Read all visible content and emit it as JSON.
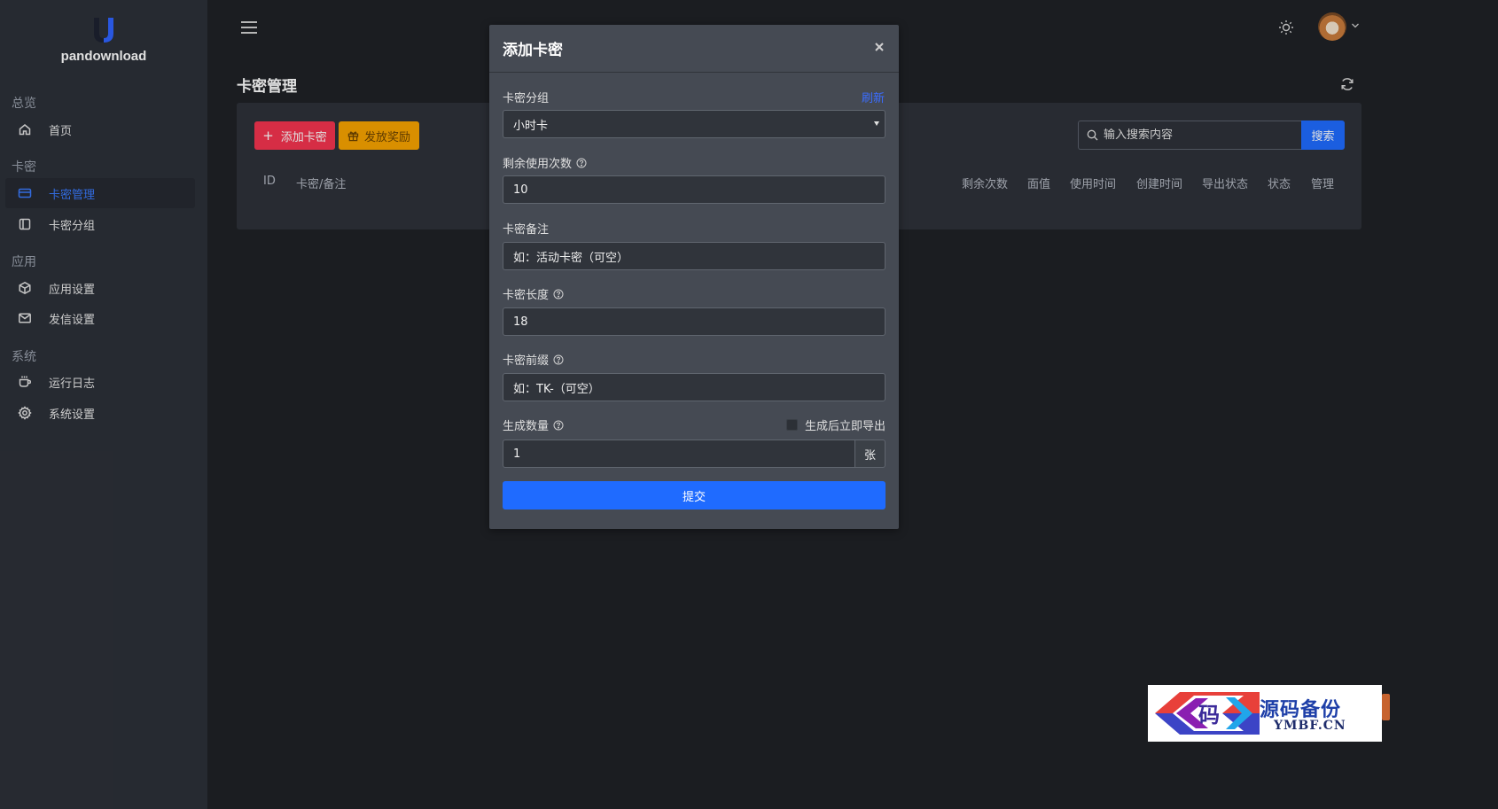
{
  "brand": {
    "name": "pandownload",
    "accent": "#3a7afe"
  },
  "sidebar": {
    "sections": [
      {
        "title": "总览",
        "items": [
          {
            "label": "首页",
            "icon": "home-icon"
          }
        ]
      },
      {
        "title": "卡密",
        "items": [
          {
            "label": "卡密管理",
            "icon": "card-icon",
            "active": true
          },
          {
            "label": "卡密分组",
            "icon": "sidebar-panel-icon"
          }
        ]
      },
      {
        "title": "应用",
        "items": [
          {
            "label": "应用设置",
            "icon": "cube-icon"
          },
          {
            "label": "发信设置",
            "icon": "mail-icon"
          }
        ]
      },
      {
        "title": "系统",
        "items": [
          {
            "label": "运行日志",
            "icon": "coffee-icon"
          },
          {
            "label": "系统设置",
            "icon": "gear-icon"
          }
        ]
      }
    ]
  },
  "page": {
    "title": "卡密管理"
  },
  "toolbar": {
    "add_label": "添加卡密",
    "reward_label": "发放奖励",
    "search_placeholder": "输入搜索内容",
    "search_label": "搜索"
  },
  "table": {
    "columns": [
      "ID",
      "卡密/备注",
      "剩余次数",
      "面值",
      "使用时间",
      "创建时间",
      "导出状态",
      "状态",
      "管理"
    ]
  },
  "modal": {
    "title": "添加卡密",
    "group_label": "卡密分组",
    "refresh_label": "刷新",
    "group_value": "小时卡",
    "uses_label": "剩余使用次数",
    "uses_value": "10",
    "note_label": "卡密备注",
    "note_placeholder": "如：活动卡密（可空）",
    "length_label": "卡密长度",
    "length_value": "18",
    "prefix_label": "卡密前缀",
    "prefix_placeholder": "如：TK-（可空）",
    "count_label": "生成数量",
    "export_label": "生成后立即导出",
    "export_checked": false,
    "count_value": "1",
    "count_unit": "张",
    "submit_label": "提交"
  },
  "watermark": {
    "title": "源码备份",
    "domain": "YMBF.CN",
    "badge": "码"
  },
  "colors": {
    "primary": "#1f6bff",
    "danger": "#f4344f",
    "warning": "#f7a300",
    "sidebar_bg": "#2c3038",
    "modal_bg": "#454a53"
  }
}
